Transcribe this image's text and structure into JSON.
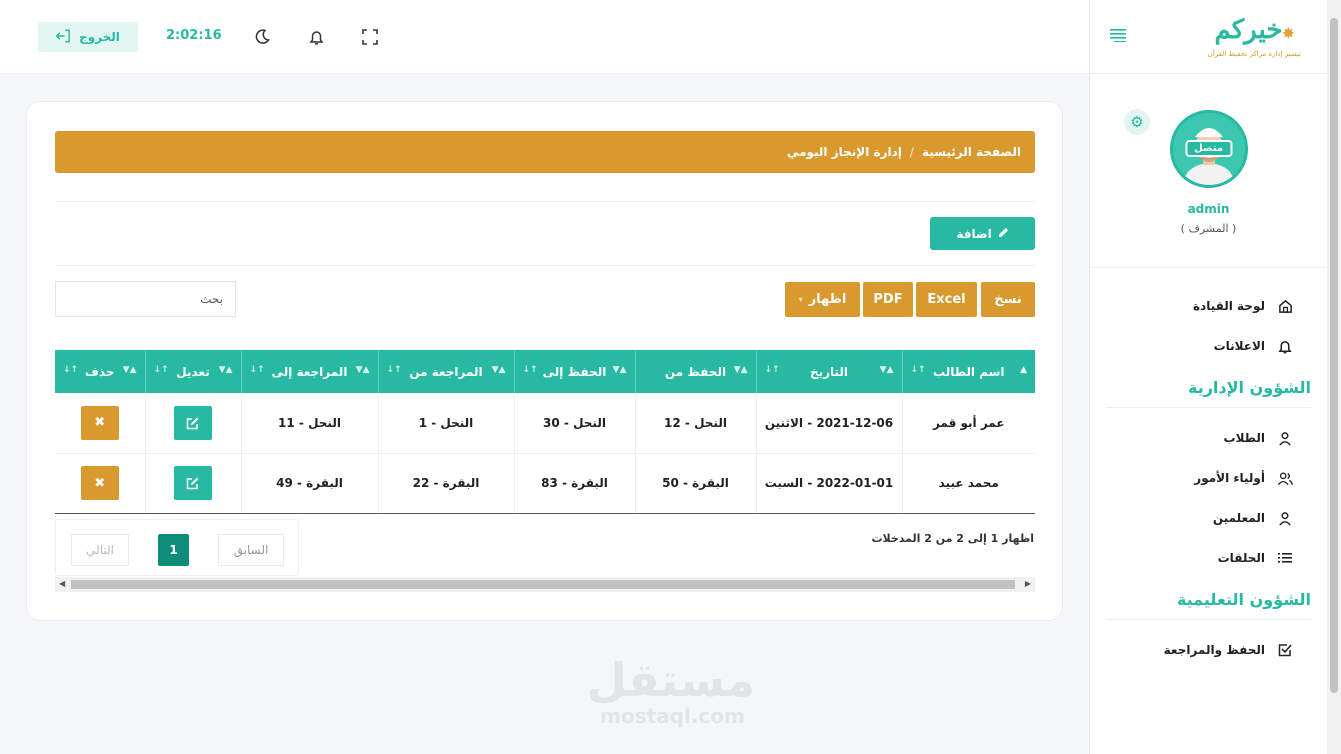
{
  "brand": {
    "logo_text": "خيركم",
    "logo_tagline": "تيسير إدارة مراكز تحفيظ القرآن"
  },
  "header": {
    "logout_label": "الخروج",
    "clock": "2:02:16"
  },
  "profile": {
    "username": "admin",
    "role": "( المشرف )",
    "status": "متصل"
  },
  "nav": {
    "dashboard": "لوحة القيادة",
    "announcements": "الاعلانات",
    "section_admin": "الشؤون الإدارية",
    "students": "الطلاب",
    "guardians": "أولياء الأمور",
    "teachers": "المعلمين",
    "circles": "الحلقات",
    "section_edu": "الشؤون التعليمية",
    "memorization": "الحفظ والمراجعة"
  },
  "breadcrumb": {
    "home": "الصفحة الرئيسية",
    "separator": "/",
    "current": "إدارة الإنجاز اليومي"
  },
  "toolbar": {
    "add_label": "اضافة",
    "copy_label": "نسخ",
    "excel_label": "Excel",
    "pdf_label": "PDF",
    "show_label": "اظهار",
    "search_placeholder": "بحث"
  },
  "table": {
    "columns": [
      "اسم الطالب",
      "التاريخ",
      "الحفظ من",
      "الحفظ إلى",
      "المراجعة من",
      "المراجعة إلى",
      "تعديل",
      "حذف"
    ],
    "rows": [
      [
        "عمر أبو قمر",
        "2021-12-06 - الاثنين",
        "النحل - 12",
        "النحل - 30",
        "النحل - 1",
        "النحل - 11"
      ],
      [
        "محمد عبيد",
        "2022-01-01 - السبت",
        "البقرة - 50",
        "البقرة - 83",
        "البقرة - 22",
        "البقرة - 49"
      ]
    ]
  },
  "pagination": {
    "info": "اظهار 1 إلى 2 من 2 المدخلات",
    "prev": "السابق",
    "current": "1",
    "next": "التالي"
  },
  "watermark": {
    "arabic": "مستقل",
    "latin": "mostaql.com"
  },
  "colors": {
    "primary": "#27b9a1",
    "accent": "#d8992f"
  }
}
